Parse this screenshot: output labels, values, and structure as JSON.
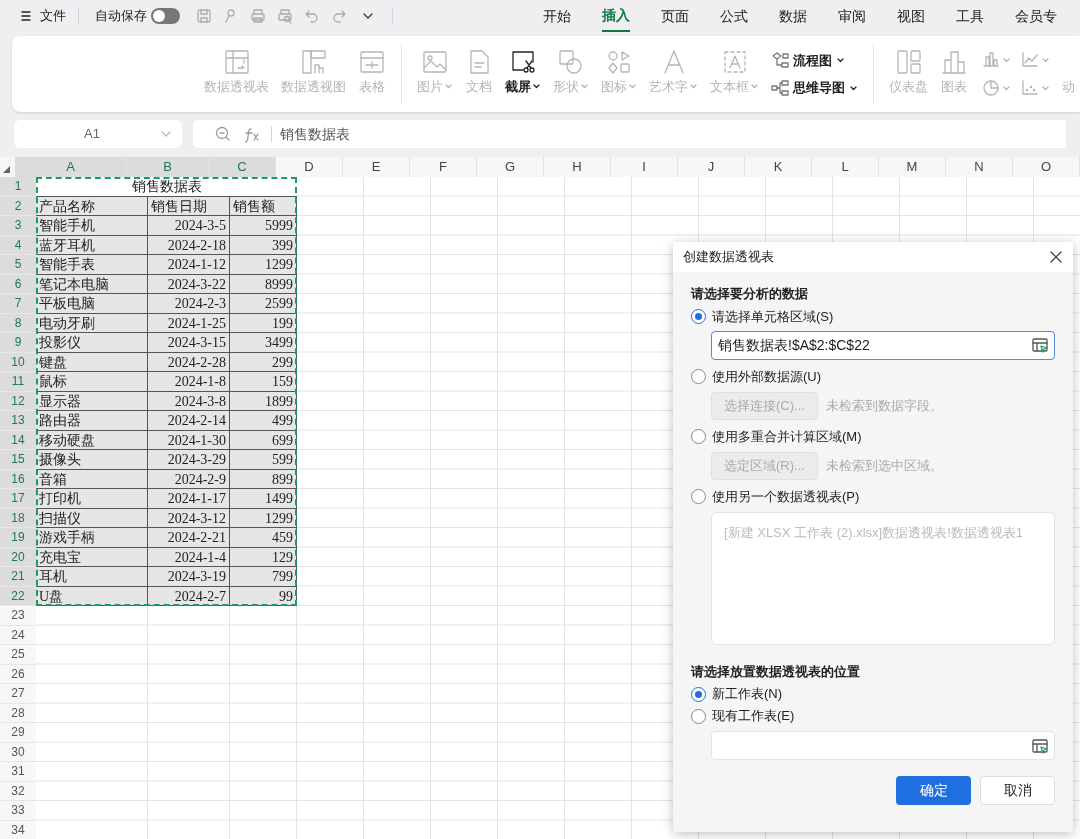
{
  "menu": {
    "file": "文件",
    "autosave": {
      "label": "自动保存",
      "on": false
    }
  },
  "tabs": [
    {
      "label": "开始",
      "selected": false
    },
    {
      "label": "插入",
      "selected": true
    },
    {
      "label": "页面",
      "selected": false
    },
    {
      "label": "公式",
      "selected": false
    },
    {
      "label": "数据",
      "selected": false
    },
    {
      "label": "审阅",
      "selected": false
    },
    {
      "label": "视图",
      "selected": false
    },
    {
      "label": "工具",
      "selected": false
    },
    {
      "label": "会员专",
      "selected": false
    }
  ],
  "ribbon": [
    {
      "kind": "large",
      "label": "数据透视表",
      "disabled": true,
      "dropdown": false
    },
    {
      "kind": "large",
      "label": "数据透视图",
      "disabled": true,
      "dropdown": false
    },
    {
      "kind": "large",
      "label": "表格",
      "disabled": true,
      "dropdown": false
    },
    {
      "kind": "divider"
    },
    {
      "kind": "large",
      "label": "图片",
      "disabled": true,
      "dropdown": true
    },
    {
      "kind": "large",
      "label": "文档",
      "disabled": true,
      "dropdown": false
    },
    {
      "kind": "large",
      "label": "截屏",
      "disabled": false,
      "dropdown": true
    },
    {
      "kind": "large",
      "label": "形状",
      "disabled": true,
      "dropdown": true
    },
    {
      "kind": "large",
      "label": "图标",
      "disabled": true,
      "dropdown": true
    },
    {
      "kind": "large",
      "label": "艺术字",
      "disabled": true,
      "dropdown": true
    },
    {
      "kind": "large",
      "label": "文本框",
      "disabled": true,
      "dropdown": true
    },
    {
      "kind": "stack",
      "items": [
        {
          "label": "流程图",
          "disabled": false
        },
        {
          "label": "思维导图",
          "disabled": false
        }
      ]
    },
    {
      "kind": "divider"
    },
    {
      "kind": "large",
      "label": "仪表盘",
      "disabled": true,
      "dropdown": false
    },
    {
      "kind": "large",
      "label": "图表",
      "disabled": true,
      "dropdown": false
    },
    {
      "kind": "charts"
    },
    {
      "kind": "cut",
      "label": "动",
      "disabled": true
    }
  ],
  "name_box": "A1",
  "formula": "销售数据表",
  "columns": [
    {
      "label": "A",
      "selected": true
    },
    {
      "label": "B",
      "selected": true
    },
    {
      "label": "C",
      "selected": true
    },
    {
      "label": "D",
      "selected": false
    },
    {
      "label": "E",
      "selected": false
    },
    {
      "label": "F",
      "selected": false
    },
    {
      "label": "G",
      "selected": false
    },
    {
      "label": "H",
      "selected": false
    },
    {
      "label": "I",
      "selected": false
    },
    {
      "label": "J",
      "selected": false
    },
    {
      "label": "K",
      "selected": false
    },
    {
      "label": "L",
      "selected": false
    },
    {
      "label": "M",
      "selected": false
    },
    {
      "label": "N",
      "selected": false
    },
    {
      "label": "O",
      "selected": false
    }
  ],
  "rows": [
    {
      "number": "1",
      "selected": true,
      "kind": "title",
      "cells": [
        "销售数据表"
      ]
    },
    {
      "number": "2",
      "selected": true,
      "kind": "header",
      "cells": [
        "产品名称",
        "销售日期",
        "销售额"
      ]
    },
    {
      "number": "3",
      "selected": true,
      "kind": "data",
      "cells": [
        "智能手机",
        "2024-3-5",
        "5999"
      ]
    },
    {
      "number": "4",
      "selected": true,
      "kind": "data",
      "cells": [
        "蓝牙耳机",
        "2024-2-18",
        "399"
      ]
    },
    {
      "number": "5",
      "selected": true,
      "kind": "data",
      "cells": [
        "智能手表",
        "2024-1-12",
        "1299"
      ]
    },
    {
      "number": "6",
      "selected": true,
      "kind": "data",
      "cells": [
        "笔记本电脑",
        "2024-3-22",
        "8999"
      ]
    },
    {
      "number": "7",
      "selected": true,
      "kind": "data",
      "cells": [
        "平板电脑",
        "2024-2-3",
        "2599"
      ]
    },
    {
      "number": "8",
      "selected": true,
      "kind": "data",
      "cells": [
        "电动牙刷",
        "2024-1-25",
        "199"
      ]
    },
    {
      "number": "9",
      "selected": true,
      "kind": "data",
      "cells": [
        "投影仪",
        "2024-3-15",
        "3499"
      ]
    },
    {
      "number": "10",
      "selected": true,
      "kind": "data",
      "cells": [
        "键盘",
        "2024-2-28",
        "299"
      ]
    },
    {
      "number": "11",
      "selected": true,
      "kind": "data",
      "cells": [
        "鼠标",
        "2024-1-8",
        "159"
      ]
    },
    {
      "number": "12",
      "selected": true,
      "kind": "data",
      "cells": [
        "显示器",
        "2024-3-8",
        "1899"
      ]
    },
    {
      "number": "13",
      "selected": true,
      "kind": "data",
      "cells": [
        "路由器",
        "2024-2-14",
        "499"
      ]
    },
    {
      "number": "14",
      "selected": true,
      "kind": "data",
      "cells": [
        "移动硬盘",
        "2024-1-30",
        "699"
      ]
    },
    {
      "number": "15",
      "selected": true,
      "kind": "data",
      "cells": [
        "摄像头",
        "2024-3-29",
        "599"
      ]
    },
    {
      "number": "16",
      "selected": true,
      "kind": "data",
      "cells": [
        "音箱",
        "2024-2-9",
        "899"
      ]
    },
    {
      "number": "17",
      "selected": true,
      "kind": "data",
      "cells": [
        "打印机",
        "2024-1-17",
        "1499"
      ]
    },
    {
      "number": "18",
      "selected": true,
      "kind": "data",
      "cells": [
        "扫描仪",
        "2024-3-12",
        "1299"
      ]
    },
    {
      "number": "19",
      "selected": true,
      "kind": "data",
      "cells": [
        "游戏手柄",
        "2024-2-21",
        "459"
      ]
    },
    {
      "number": "20",
      "selected": true,
      "kind": "data",
      "cells": [
        "充电宝",
        "2024-1-4",
        "129"
      ]
    },
    {
      "number": "21",
      "selected": true,
      "kind": "data",
      "cells": [
        "耳机",
        "2024-3-19",
        "799"
      ]
    },
    {
      "number": "22",
      "selected": true,
      "kind": "data",
      "cells": [
        "U盘",
        "2024-2-7",
        "99"
      ]
    },
    {
      "number": "23",
      "selected": false,
      "kind": "empty"
    },
    {
      "number": "24",
      "selected": false,
      "kind": "empty"
    },
    {
      "number": "25",
      "selected": false,
      "kind": "empty"
    },
    {
      "number": "26",
      "selected": false,
      "kind": "empty"
    },
    {
      "number": "27",
      "selected": false,
      "kind": "empty"
    },
    {
      "number": "28",
      "selected": false,
      "kind": "empty"
    },
    {
      "number": "29",
      "selected": false,
      "kind": "empty"
    },
    {
      "number": "30",
      "selected": false,
      "kind": "empty"
    },
    {
      "number": "31",
      "selected": false,
      "kind": "empty"
    },
    {
      "number": "32",
      "selected": false,
      "kind": "empty"
    },
    {
      "number": "33",
      "selected": false,
      "kind": "empty"
    },
    {
      "number": "34",
      "selected": false,
      "kind": "empty"
    }
  ],
  "dialog": {
    "title": "创建数据透视表",
    "source_heading": "请选择要分析的数据",
    "source_options": [
      {
        "label": "请选择单元格区域(S)",
        "selected": true,
        "kind": "range",
        "value": "销售数据表!$A$2:$C$22"
      },
      {
        "label": "使用外部数据源(U)",
        "selected": false,
        "kind": "button",
        "button": "选择连接(C)...",
        "note": "未检索到数据字段。"
      },
      {
        "label": "使用多重合并计算区域(M)",
        "selected": false,
        "kind": "button",
        "button": "选定区域(R)...",
        "note": "未检索到选中区域。"
      },
      {
        "label": "使用另一个数据透视表(P)",
        "selected": false,
        "kind": "list",
        "value": "[新建 XLSX 工作表 (2).xlsx]数据透视表!数据透视表1"
      }
    ],
    "placement_heading": "请选择放置数据透视表的位置",
    "placement_options": [
      {
        "label": "新工作表(N)",
        "selected": true
      },
      {
        "label": "现有工作表(E)",
        "selected": false
      }
    ],
    "buttons": [
      {
        "label": "确定",
        "primary": true
      },
      {
        "label": "取消",
        "primary": false
      }
    ]
  }
}
